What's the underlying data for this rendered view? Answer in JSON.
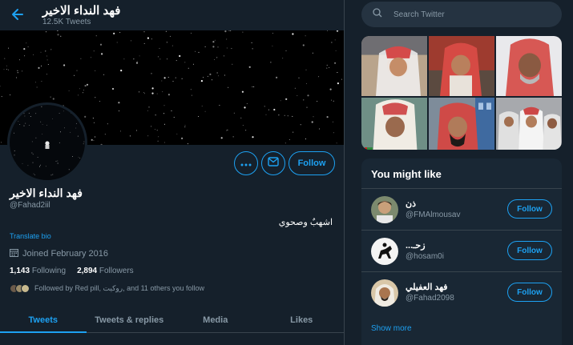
{
  "header": {
    "title": "فهد النداء الاخير",
    "tweet_count": "12.5K Tweets"
  },
  "profile": {
    "display_name": "فهد النداء الاخير",
    "handle": "@Fahad2iil",
    "bio": "اشهبٌ وصحوي",
    "translate_label": "Translate bio",
    "joined": "Joined February 2016",
    "following_count": "1,143",
    "following_label": "Following",
    "followers_count": "2,894",
    "followers_label": "Followers",
    "followed_by": "Followed by Red pill, روكيت, and 11 others you follow",
    "follow_label": "Follow"
  },
  "tabs": [
    {
      "label": "Tweets"
    },
    {
      "label": "Tweets & replies"
    },
    {
      "label": "Media"
    },
    {
      "label": "Likes"
    }
  ],
  "sidebar": {
    "search_placeholder": "Search Twitter",
    "you_might_like": "You might like",
    "suggestions": [
      {
        "name": "ذن",
        "handle": "@FMAlmousav",
        "follow": "Follow"
      },
      {
        "name": "زحـ...",
        "handle": "@hosam0i",
        "follow": "Follow"
      },
      {
        "name": "فهد العفيلي",
        "handle": "@Fahad2098",
        "follow": "Follow"
      }
    ],
    "show_more": "Show more"
  },
  "colors": {
    "background": "#15202b",
    "accent": "#1da1f2",
    "muted": "#8899a6"
  }
}
